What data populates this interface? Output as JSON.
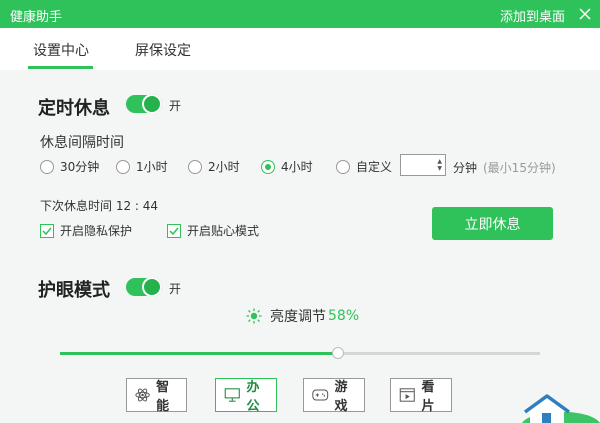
{
  "window": {
    "title": "健康助手",
    "add_to_desktop": "添加到桌面"
  },
  "tabs": [
    {
      "label": "设置中心",
      "active": true
    },
    {
      "label": "屏保设定",
      "active": false
    }
  ],
  "rest": {
    "title": "定时休息",
    "toggle_text": "开",
    "interval_label": "休息间隔时间",
    "options": [
      {
        "label": "30分钟"
      },
      {
        "label": "1小时"
      },
      {
        "label": "2小时"
      },
      {
        "label": "4小时",
        "selected": true
      },
      {
        "label": "自定义"
      }
    ],
    "custom_value": "",
    "custom_unit": "分钟",
    "custom_hint": "(最小15分钟)",
    "next_rest": "下次休息时间 12 : 44",
    "privacy_label": "开启隐私保护",
    "care_label": "开启贴心模式",
    "rest_now": "立即休息"
  },
  "eye": {
    "title": "护眼模式",
    "toggle_text": "开",
    "brightness_label": "亮度调节",
    "brightness_value": "58%",
    "brightness": 0.58,
    "modes": [
      {
        "label": "智能"
      },
      {
        "label": "办公",
        "active": true
      },
      {
        "label": "游戏"
      },
      {
        "label": "看片"
      }
    ]
  },
  "colors": {
    "accent": "#2fc25b",
    "background": "#f3f6f4"
  }
}
